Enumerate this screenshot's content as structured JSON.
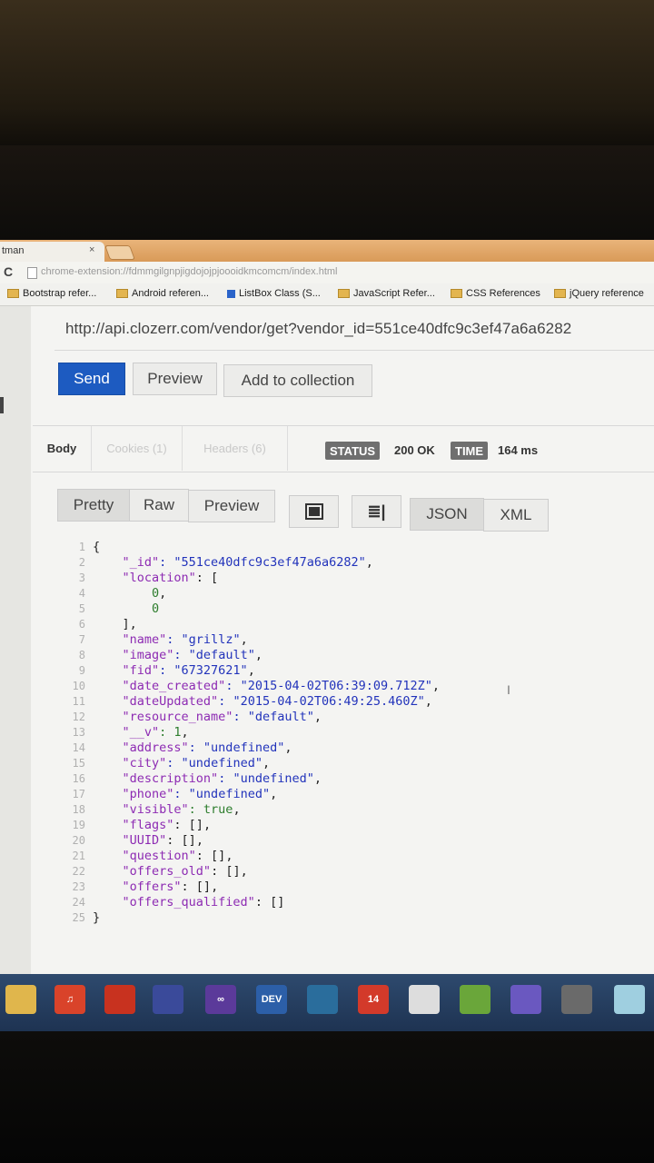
{
  "browser": {
    "tab_title": "tman",
    "tab_close": "×",
    "url": "chrome-extension://fdmmgilgnpjigdojojpjoooidkmcomcm/index.html",
    "bookmarks": [
      {
        "label": "Bootstrap refer..."
      },
      {
        "label": "Android referen..."
      },
      {
        "label": "ListBox Class (S..."
      },
      {
        "label": "JavaScript Refer..."
      },
      {
        "label": "CSS References"
      },
      {
        "label": "jQuery reference"
      }
    ]
  },
  "request": {
    "url": "http://api.clozerr.com/vendor/get?vendor_id=551ce40dfc9c3ef47a6a6282",
    "send_label": "Send",
    "preview_label": "Preview",
    "collection_label": "Add to collection"
  },
  "response": {
    "tabs": {
      "body": "Body",
      "cookies": "Cookies (1)",
      "headers": "Headers (6)"
    },
    "status_label": "STATUS",
    "status_value": "200 OK",
    "time_label": "TIME",
    "time_value": "164 ms"
  },
  "formats": {
    "pretty": "Pretty",
    "raw": "Raw",
    "preview": "Preview",
    "json": "JSON",
    "xml": "XML"
  },
  "code_lines": [
    {
      "n": "1",
      "indent": "",
      "key": "",
      "text": "{",
      "punct": ""
    },
    {
      "n": "2",
      "indent": "    ",
      "key": "\"_id\"",
      "text": ": \"551ce40dfc9c3ef47a6a6282\"",
      "punct": ","
    },
    {
      "n": "3",
      "indent": "    ",
      "key": "\"location\"",
      "text": ": [",
      "punct": ""
    },
    {
      "n": "4",
      "indent": "        ",
      "key": "",
      "text": "0",
      "punct": ","
    },
    {
      "n": "5",
      "indent": "        ",
      "key": "",
      "text": "0",
      "punct": ""
    },
    {
      "n": "6",
      "indent": "    ",
      "key": "",
      "text": "]",
      "punct": ","
    },
    {
      "n": "7",
      "indent": "    ",
      "key": "\"name\"",
      "text": ": \"grillz\"",
      "punct": ","
    },
    {
      "n": "8",
      "indent": "    ",
      "key": "\"image\"",
      "text": ": \"default\"",
      "punct": ","
    },
    {
      "n": "9",
      "indent": "    ",
      "key": "\"fid\"",
      "text": ": \"67327621\"",
      "punct": ","
    },
    {
      "n": "10",
      "indent": "    ",
      "key": "\"date_created\"",
      "text": ": \"2015-04-02T06:39:09.712Z\"",
      "punct": ","
    },
    {
      "n": "11",
      "indent": "    ",
      "key": "\"dateUpdated\"",
      "text": ": \"2015-04-02T06:49:25.460Z\"",
      "punct": ","
    },
    {
      "n": "12",
      "indent": "    ",
      "key": "\"resource_name\"",
      "text": ": \"default\"",
      "punct": ","
    },
    {
      "n": "13",
      "indent": "    ",
      "key": "\"__v\"",
      "text": ": 1",
      "punct": ","
    },
    {
      "n": "14",
      "indent": "    ",
      "key": "\"address\"",
      "text": ": \"undefined\"",
      "punct": ","
    },
    {
      "n": "15",
      "indent": "    ",
      "key": "\"city\"",
      "text": ": \"undefined\"",
      "punct": ","
    },
    {
      "n": "16",
      "indent": "    ",
      "key": "\"description\"",
      "text": ": \"undefined\"",
      "punct": ","
    },
    {
      "n": "17",
      "indent": "    ",
      "key": "\"phone\"",
      "text": ": \"undefined\"",
      "punct": ","
    },
    {
      "n": "18",
      "indent": "    ",
      "key": "\"visible\"",
      "text": ": true",
      "punct": ","
    },
    {
      "n": "19",
      "indent": "    ",
      "key": "\"flags\"",
      "text": ": []",
      "punct": ","
    },
    {
      "n": "20",
      "indent": "    ",
      "key": "\"UUID\"",
      "text": ": []",
      "punct": ","
    },
    {
      "n": "21",
      "indent": "    ",
      "key": "\"question\"",
      "text": ": []",
      "punct": ","
    },
    {
      "n": "22",
      "indent": "    ",
      "key": "\"offers_old\"",
      "text": ": []",
      "punct": ","
    },
    {
      "n": "23",
      "indent": "    ",
      "key": "\"offers\"",
      "text": ": []",
      "punct": ","
    },
    {
      "n": "24",
      "indent": "    ",
      "key": "\"offers_qualified\"",
      "text": ": []",
      "punct": ""
    },
    {
      "n": "25",
      "indent": "",
      "key": "",
      "text": "}",
      "punct": ""
    }
  ],
  "taskbar": {
    "devexpress_label": "DEV",
    "badge_14": "14"
  },
  "colors": {
    "send_blue": "#1d5bc1",
    "json_key": "#8d2bb3",
    "json_string": "#2233bb"
  }
}
